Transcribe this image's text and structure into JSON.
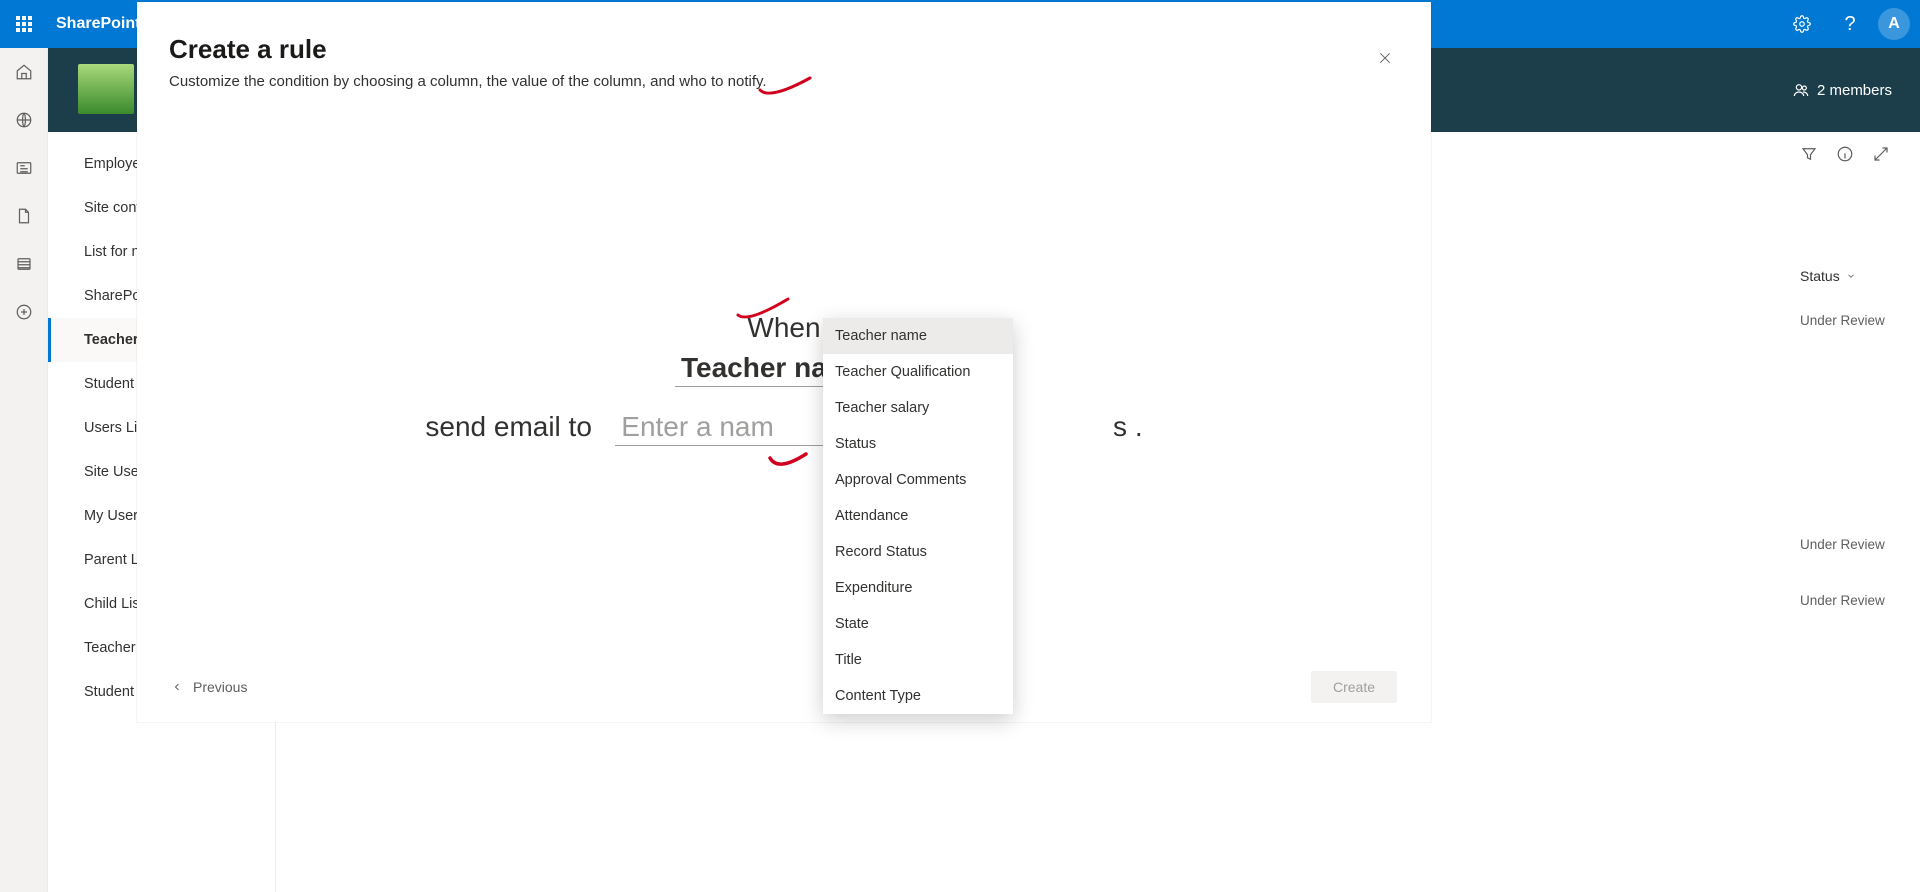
{
  "suitebar": {
    "brand": "SharePoint",
    "avatar_initial": "A"
  },
  "siteband": {
    "members_label": "2 members"
  },
  "leftnav": {
    "items": [
      {
        "label": "Employee"
      },
      {
        "label": "Site cont"
      },
      {
        "label": "List for n"
      },
      {
        "label": "SharePoi"
      },
      {
        "label": "Teachers"
      },
      {
        "label": "Student "
      },
      {
        "label": "Users Lis"
      },
      {
        "label": "Site User"
      },
      {
        "label": "My Users"
      },
      {
        "label": "Parent Li"
      },
      {
        "label": "Child Lis"
      },
      {
        "label": "Teacher "
      },
      {
        "label": "Student "
      }
    ]
  },
  "right_column": {
    "header": "Status",
    "cells": [
      "Under Review",
      "",
      "",
      "",
      "Under Review",
      "Under Review"
    ]
  },
  "panel": {
    "title": "Create a rule",
    "subtitle": "Customize the condition by choosing a column, the value of the column, and who to notify.",
    "when_text": "When",
    "column_selected": "Teacher name",
    "send_prefix": "send email to",
    "name_placeholder": "Enter a nam",
    "trail_text": "s .",
    "previous_label": "Previous",
    "create_label": "Create"
  },
  "dropdown": {
    "options": [
      "Teacher name",
      "Teacher Qualification",
      "Teacher salary",
      "Status",
      "Approval Comments",
      "Attendance",
      "Record Status",
      "Expenditure",
      "State",
      "Title",
      "Content Type"
    ]
  }
}
